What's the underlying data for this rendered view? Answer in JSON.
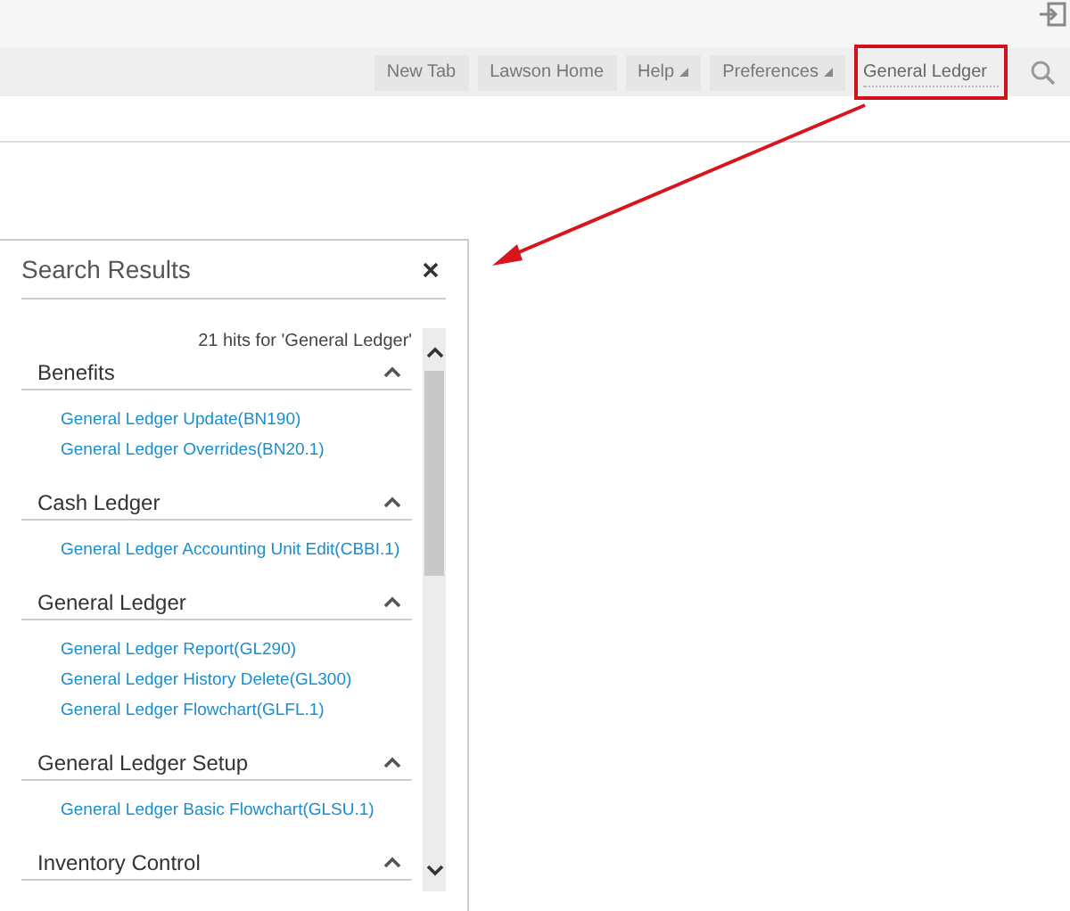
{
  "toolbar": {
    "buttons": [
      {
        "label": "New Tab",
        "kind": "plain"
      },
      {
        "label": "Lawson Home",
        "kind": "plain"
      },
      {
        "label": "Help",
        "kind": "menu"
      },
      {
        "label": "Preferences",
        "kind": "menu"
      }
    ],
    "search": {
      "value": "General Ledger",
      "highlighted": true
    }
  },
  "panel": {
    "title": "Search Results",
    "hits": "21 hits for 'General Ledger'",
    "sections": [
      {
        "title": "Benefits",
        "expanded": true,
        "links": [
          "General Ledger Update(BN190)",
          "General Ledger Overrides(BN20.1)"
        ]
      },
      {
        "title": "Cash Ledger",
        "expanded": true,
        "links": [
          "General Ledger Accounting Unit Edit(CBBI.1)"
        ]
      },
      {
        "title": "General Ledger",
        "expanded": true,
        "links": [
          "General Ledger Report(GL290)",
          "General Ledger History Delete(GL300)",
          "General Ledger Flowchart(GLFL.1)"
        ]
      },
      {
        "title": "General Ledger Setup",
        "expanded": true,
        "links": [
          "General Ledger Basic Flowchart(GLSU.1)"
        ]
      },
      {
        "title": "Inventory Control",
        "expanded": true
      }
    ]
  }
}
